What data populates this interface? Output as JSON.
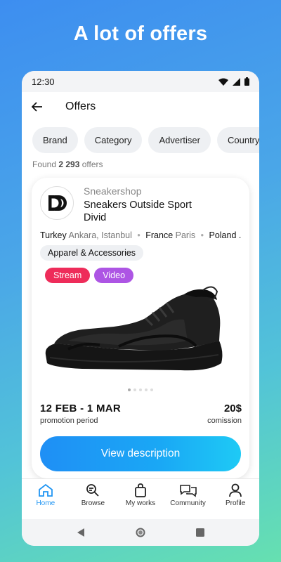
{
  "promo": {
    "title": "A lot of offers"
  },
  "status_bar": {
    "time": "12:30"
  },
  "header": {
    "title": "Offers"
  },
  "filters": [
    "Brand",
    "Category",
    "Advertiser",
    "Country"
  ],
  "results": {
    "prefix": "Found",
    "count": "2 293",
    "suffix": "offers"
  },
  "offer": {
    "shop_name": "Sneakershop",
    "title": "Sneakers Outside Sport Divid",
    "locations": [
      {
        "country": "Turkey",
        "cities": "Ankara, Istanbul"
      },
      {
        "country": "France",
        "cities": "Paris"
      },
      {
        "country": "Poland ...",
        "cities": ""
      }
    ],
    "category": "Apparel & Accessories",
    "tags": [
      "Stream",
      "Video"
    ],
    "image_count": 5,
    "active_image": 0,
    "period_dates": "12 FEB - 1 MAR",
    "period_label": "promotion period",
    "commission_value": "20$",
    "commission_label": "comission",
    "cta": "View description"
  },
  "bottom_nav": [
    {
      "label": "Home",
      "icon": "home-icon",
      "active": true
    },
    {
      "label": "Browse",
      "icon": "search-list-icon",
      "active": false
    },
    {
      "label": "My works",
      "icon": "bag-icon",
      "active": false
    },
    {
      "label": "Community",
      "icon": "chat-bubbles-icon",
      "active": false
    },
    {
      "label": "Profile",
      "icon": "person-icon",
      "active": false
    }
  ],
  "colors": {
    "accent": "#2196f3",
    "stream_tag": "#ee2c5a",
    "video_tag": "#ad55e4"
  }
}
